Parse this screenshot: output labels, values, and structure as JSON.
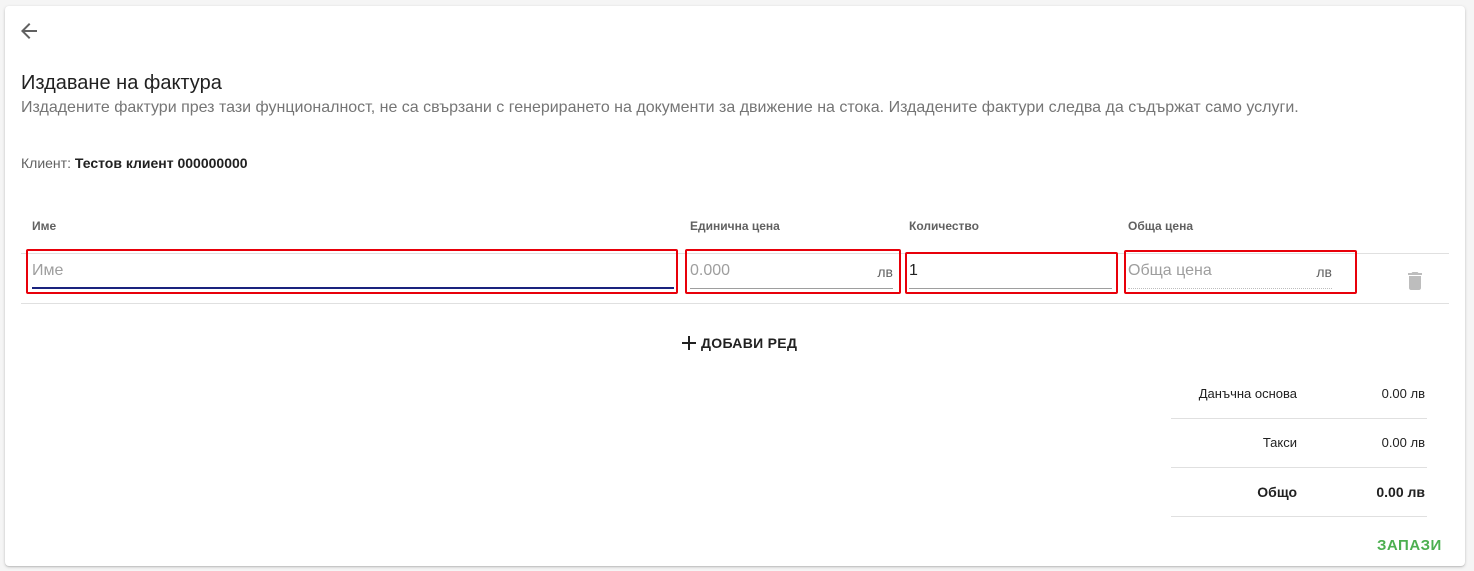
{
  "header": {
    "title": "Издаване на фактура",
    "subtitle": "Издадените фактури през тази фунционалност, не са свързани с генерирането на документи за движение на стока. Издадените фактури следва да съдържат само услуги."
  },
  "client": {
    "label": "Клиент:",
    "value": "Тестов клиент 000000000"
  },
  "table": {
    "columns": [
      "Име",
      "Единична цена",
      "Количество",
      "Обща цена"
    ],
    "row": {
      "name_value": "",
      "name_placeholder": "Име",
      "unit_price_value": "",
      "unit_price_placeholder": "0.000",
      "unit_price_suffix": "лв",
      "quantity_value": "1",
      "total_value": "",
      "total_placeholder": "Обща цена",
      "total_suffix": "лв"
    }
  },
  "add_row_label": "ДОБАВИ РЕД",
  "totals": {
    "rows": [
      {
        "label": "Данъчна основа",
        "value": "0.00 лв"
      },
      {
        "label": "Такси",
        "value": "0.00 лв"
      },
      {
        "label": "Общо",
        "value": "0.00 лв"
      }
    ]
  },
  "save_label": "ЗАПАЗИ",
  "icons": {
    "back": "arrow-left-icon",
    "delete": "trash-icon",
    "add": "plus-icon"
  },
  "colors": {
    "accent": "#1a237e",
    "save": "#4caf50",
    "highlight": "#e8000a"
  }
}
